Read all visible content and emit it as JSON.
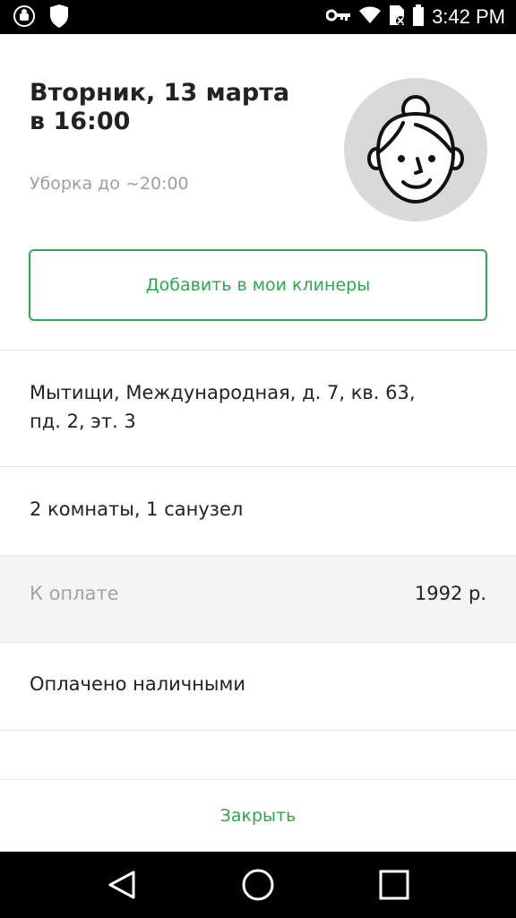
{
  "status_bar": {
    "time": "3:42 PM",
    "icons": [
      "android-notification-icon",
      "shield-icon",
      "vpn-key-icon",
      "wifi-icon",
      "sim-off-icon",
      "battery-icon"
    ]
  },
  "order": {
    "date": "Вторник, 13 марта",
    "time": "в 16:00",
    "duration_note": "Уборка до ~20:00",
    "avatar_icon": "cleaner-avatar-icon"
  },
  "add_cleaner_button": "Добавить в мои клинеры",
  "address": {
    "line1": "Мытищи, Международная, д. 7, кв. 63,",
    "line2": "пд. 2, эт. 3"
  },
  "rooms": "2 комнаты, 1 санузел",
  "payment": {
    "label": "К оплате",
    "amount": "1992 р."
  },
  "payment_method": "Оплачено наличными",
  "close_button": "Закрыть",
  "colors": {
    "accent": "#2ea84f",
    "muted_text": "#9e9e9e",
    "avatar_bg": "#d9d9d9",
    "pay_row_bg": "#f4f4f4"
  },
  "nav_bar": {
    "icons": [
      "back-icon",
      "home-icon",
      "recents-icon"
    ]
  }
}
